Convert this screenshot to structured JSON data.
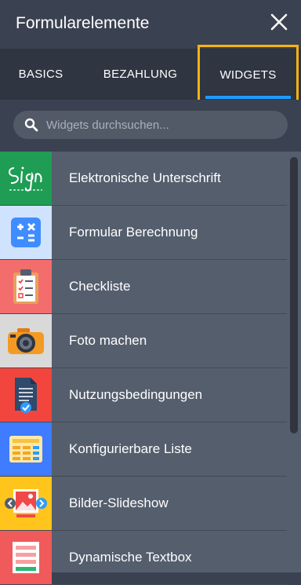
{
  "header": {
    "title": "Formularelemente"
  },
  "tabs": [
    {
      "label": "BASICS"
    },
    {
      "label": "BEZAHLUNG"
    },
    {
      "label": "WIDGETS"
    }
  ],
  "search": {
    "placeholder": "Widgets durchsuchen..."
  },
  "widgets": [
    {
      "label": "Elektronische Unterschrift",
      "icon": "signature-icon",
      "bg": "#1f9d55"
    },
    {
      "label": "Formular Berechnung",
      "icon": "calculator-icon",
      "bg": "#cfe3ff"
    },
    {
      "label": "Checkliste",
      "icon": "clipboard-icon",
      "bg": "#f46d6d"
    },
    {
      "label": "Foto machen",
      "icon": "camera-icon",
      "bg": "#d9d9d9"
    },
    {
      "label": "Nutzungsbedingungen",
      "icon": "document-check-icon",
      "bg": "#f2453d"
    },
    {
      "label": "Konfigurierbare Liste",
      "icon": "list-table-icon",
      "bg": "#3f7cff"
    },
    {
      "label": "Bilder-Slideshow",
      "icon": "image-slideshow-icon",
      "bg": "#ffc51c"
    },
    {
      "label": "Dynamische Textbox",
      "icon": "textbox-icon",
      "bg": "#f15a5a"
    }
  ],
  "colors": {
    "highlight": "#f6b311",
    "active_tab": "#1e9bff"
  }
}
